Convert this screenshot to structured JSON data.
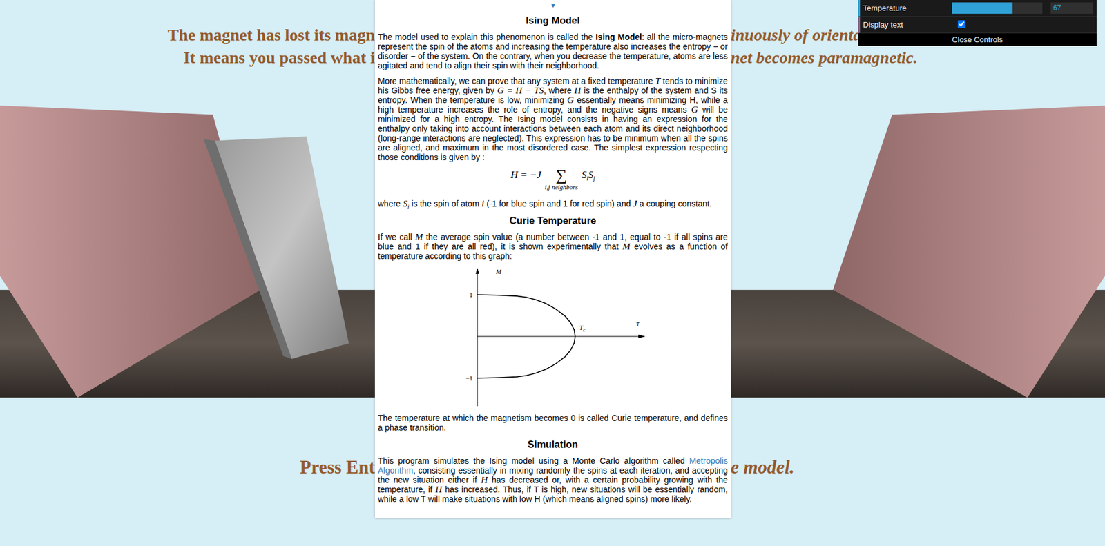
{
  "headline": {
    "left": [
      "The magnet has lost its magn",
      "It means you passed what i"
    ],
    "right": [
      "inuously of orienta",
      "net becomes paramagnetic."
    ]
  },
  "prompt": {
    "left": "Press Ent",
    "right": "e model."
  },
  "panel": {
    "toggle": "▾",
    "sections": [
      {
        "kind": "heading",
        "text": "Ising Model"
      },
      {
        "kind": "paragraph",
        "segments": [
          {
            "kind": "text",
            "text": "The model used to explain this phenomenon is called the "
          },
          {
            "kind": "bold",
            "text": "Ising Model"
          },
          {
            "kind": "text",
            "text": ": all the micro-magnets represent the spin of the atoms and increasing the temperature also increases the entropy − or disorder − of the system. On the contrary, when you decrease the temperature, atoms are less agitated and tend to align their spin with their neighborhood."
          }
        ]
      },
      {
        "kind": "paragraph",
        "segments": [
          {
            "kind": "text",
            "text": "More mathematically, we can prove that any system at a fixed temperature "
          },
          {
            "kind": "math",
            "text": "T"
          },
          {
            "kind": "text",
            "text": " tends to minimize his Gibbs free energy, given by "
          },
          {
            "kind": "math",
            "text": "G = H − TS"
          },
          {
            "kind": "text",
            "text": ", where "
          },
          {
            "kind": "math",
            "text": "H"
          },
          {
            "kind": "text",
            "text": " is the enthalpy of the system and S its entropy. When the temperature is low, minimizing "
          },
          {
            "kind": "math",
            "text": "G"
          },
          {
            "kind": "text",
            "text": " essentially means minimizing H, while a high temperature increases the role of entropy, and the negative signs means "
          },
          {
            "kind": "math",
            "text": "G"
          },
          {
            "kind": "text",
            "text": " will be minimized for a high entropy. The Ising model consists in having an expression for the enthalpy only taking into account interactions between each atom and its direct neighborhood (long-range interactions are neglected). This expression has to be minimum when all the spins are aligned, and maximum in the most disordered case. The simplest expression respecting those conditions is given by :"
          }
        ]
      },
      {
        "kind": "equation",
        "lhs": "H = −J",
        "operator": "∑",
        "under": "i,j neighbors",
        "factors": [
          {
            "base": "S",
            "sub": "i"
          },
          {
            "base": "S",
            "sub": "j"
          }
        ]
      },
      {
        "kind": "paragraph",
        "segments": [
          {
            "kind": "text",
            "text": "where "
          },
          {
            "kind": "math",
            "text": "S",
            "sub": "i"
          },
          {
            "kind": "text",
            "text": " is the spin of atom "
          },
          {
            "kind": "math",
            "text": "i"
          },
          {
            "kind": "text",
            "text": " (-1 for blue spin and 1 for red spin) and "
          },
          {
            "kind": "math",
            "text": "J"
          },
          {
            "kind": "text",
            "text": " a couping constant."
          }
        ]
      },
      {
        "kind": "heading",
        "text": "Curie Temperature"
      },
      {
        "kind": "paragraph",
        "segments": [
          {
            "kind": "text",
            "text": "If we call "
          },
          {
            "kind": "math",
            "text": "M"
          },
          {
            "kind": "text",
            "text": " the average spin value (a number between -1 and 1, equal to -1 if all spins are blue and 1 if they are all red), it is shown experimentally that "
          },
          {
            "kind": "math",
            "text": "M"
          },
          {
            "kind": "text",
            "text": " evolves as a function of temperature according to this graph:"
          }
        ]
      },
      {
        "kind": "chart",
        "y_label": "M",
        "x_label": "T",
        "critical": {
          "base": "T",
          "sub": "c",
          "value": 1
        },
        "y_ticks": [
          {
            "label": "1",
            "value": 1
          },
          {
            "label": "−1",
            "value": -1
          }
        ],
        "series": [
          {
            "name": "upper",
            "t": [
              0,
              0.2,
              0.4,
              0.5,
              0.6,
              0.7,
              0.8,
              0.9,
              0.95,
              0.99,
              1
            ],
            "m": [
              1,
              0.99,
              0.97,
              0.94,
              0.88,
              0.79,
              0.66,
              0.48,
              0.34,
              0.16,
              0
            ]
          },
          {
            "name": "lower",
            "t": [
              0,
              0.2,
              0.4,
              0.5,
              0.6,
              0.7,
              0.8,
              0.9,
              0.95,
              0.99,
              1
            ],
            "m": [
              -1,
              -0.99,
              -0.97,
              -0.94,
              -0.88,
              -0.79,
              -0.66,
              -0.48,
              -0.34,
              -0.16,
              0
            ]
          }
        ]
      },
      {
        "kind": "paragraph",
        "segments": [
          {
            "kind": "text",
            "text": "The temperature at which the magnetism becomes 0 is called Curie temperature, and defines a phase transition."
          }
        ]
      },
      {
        "kind": "heading",
        "text": "Simulation"
      },
      {
        "kind": "paragraph",
        "segments": [
          {
            "kind": "text",
            "text": "This program simulates the Ising model using a Monte Carlo algorithm called "
          },
          {
            "kind": "link",
            "text": "Metropolis Algorithm"
          },
          {
            "kind": "text",
            "text": ", consisting essentially in mixing randomly the spins at each iteration, and accepting the new situation either if "
          },
          {
            "kind": "math",
            "text": "H"
          },
          {
            "kind": "text",
            "text": " has decreased or, with a certain probability growing with the temperature, if "
          },
          {
            "kind": "math",
            "text": "H"
          },
          {
            "kind": "text",
            "text": " has increased. Thus, if T is high, new situations will be essentially random, while a low T will make situations with low H (which means aligned spins) more likely."
          }
        ]
      }
    ]
  },
  "controls": {
    "rows": [
      {
        "kind": "slider",
        "label": "Temperature",
        "level": 0.67,
        "reading": "67"
      },
      {
        "kind": "checkbox",
        "label": "Display text",
        "checked": true
      }
    ],
    "close": "Close Controls"
  }
}
